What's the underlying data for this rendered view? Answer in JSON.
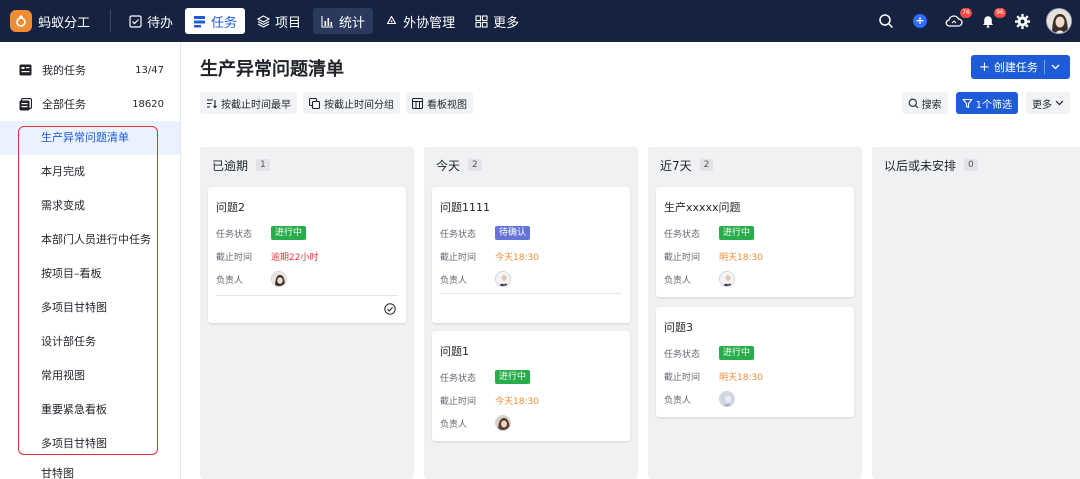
{
  "colors": {
    "topbar": "#152341",
    "accent": "#1e5bd6",
    "status_green": "#27ad4a",
    "status_purple": "#6673d9",
    "overdue_red": "#e5313a",
    "due_orange": "#f08c32",
    "highlight_frame": "#e5313a"
  },
  "topbar": {
    "brand": "蚂蚁分工",
    "nav": [
      {
        "label": "待办",
        "icon": "checkbox-icon"
      },
      {
        "label": "任务",
        "icon": "list-icon",
        "active": true
      },
      {
        "label": "项目",
        "icon": "layers-icon"
      },
      {
        "label": "统计",
        "icon": "bar-chart-icon"
      },
      {
        "label": "外协管理",
        "icon": "recycle-icon"
      },
      {
        "label": "更多",
        "icon": "grid-icon"
      }
    ],
    "badges": {
      "cloud": "76",
      "bell": "96"
    }
  },
  "sidebar": {
    "my_tasks": {
      "label": "我的任务",
      "count": "13/47"
    },
    "all_tasks": {
      "label": "全部任务",
      "count": "18620"
    },
    "views": [
      "生产异常问题清单",
      "本月完成",
      "需求变成",
      "本部门人员进行中任务",
      "按项目–看板",
      "多项目甘特图",
      "设计部任务",
      "常用视图",
      "重要紧急看板",
      "多项目甘特图"
    ],
    "cut_off_item": "甘特图"
  },
  "main": {
    "title": "生产异常问题清单",
    "create_label": "创建任务",
    "toolbar": {
      "sort_label": "按截止时间最早",
      "group_label": "按截止时间分组",
      "board_label": "看板视图",
      "search_label": "搜索",
      "filter_label": "1个筛选",
      "more_label": "更多"
    }
  },
  "board": {
    "field_labels": {
      "status": "任务状态",
      "due": "截止时间",
      "owner": "负责人"
    },
    "columns": [
      {
        "title": "已逾期",
        "count": "1",
        "cards": [
          {
            "title": "问题2",
            "status": "进行中",
            "due": "逾期22小时"
          }
        ]
      },
      {
        "title": "今天",
        "count": "2",
        "cards": [
          {
            "title": "问题1111",
            "status": "待确认",
            "due": "今天18:30"
          },
          {
            "title": "问题1",
            "status": "进行中",
            "due": "今天18:30"
          }
        ]
      },
      {
        "title": "近7天",
        "count": "2",
        "cards": [
          {
            "title": "生产xxxxx问题",
            "status": "进行中",
            "due": "明天18:30"
          },
          {
            "title": "问题3",
            "status": "进行中",
            "due": "明天18:30"
          }
        ]
      },
      {
        "title": "以后或未安排",
        "count": "0",
        "cards": []
      }
    ]
  }
}
